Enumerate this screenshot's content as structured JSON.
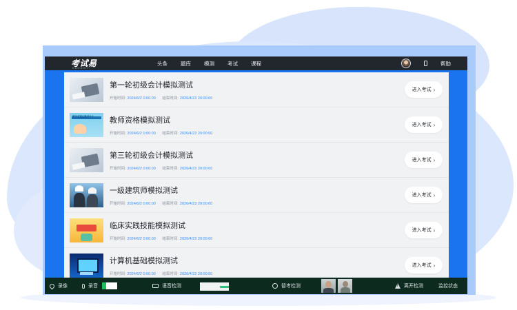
{
  "header": {
    "logo": "考试易",
    "logo_sub": "KAOSHIYI",
    "nav": [
      "头条",
      "题库",
      "模测",
      "考试",
      "课程"
    ],
    "help": "帮助"
  },
  "exams": [
    {
      "title": "第一轮初级会计模拟测试",
      "thumb": "calculator-thumbnail",
      "start_label": "开始时间:",
      "start": "2024/6/2 0:00:00",
      "end_label": "结束时间:",
      "end": "2026/4/23 20:00:00",
      "button": "进入考试"
    },
    {
      "title": "教师资格模拟测试",
      "thumb": "teacher-thumbnail",
      "thumb_text": "教师资格证备考什么",
      "start_label": "开始时间:",
      "start": "2024/6/2 0:00:00",
      "end_label": "结束时间:",
      "end": "2026/4/23 20:00:00",
      "button": "进入考试"
    },
    {
      "title": "第三轮初级会计模拟测试",
      "thumb": "calculator-thumbnail",
      "start_label": "开始时间:",
      "start": "2024/6/2 0:00:00",
      "end_label": "结束时间:",
      "end": "2026/4/23 20:00:00",
      "button": "进入考试"
    },
    {
      "title": "一级建筑师模拟测试",
      "thumb": "architects-thumbnail",
      "start_label": "开始时间:",
      "start": "2024/6/2 0:00:00",
      "end_label": "结束时间:",
      "end": "2026/4/23 20:00:00",
      "button": "进入考试"
    },
    {
      "title": "临床实践技能模拟测试",
      "thumb": "clinical-thumbnail",
      "start_label": "开始时间:",
      "start": "2024/6/2 0:00:00",
      "end_label": "结束时间:",
      "end": "2026/4/23 20:00:00",
      "button": "进入考试"
    },
    {
      "title": "计算机基础模拟测试",
      "thumb": "computer-thumbnail",
      "start_label": "开始时间:",
      "start": "2024/6/2 0:00:00",
      "end_label": "结束时间:",
      "end": "2026/4/23 20:00:00",
      "button": "进入考试"
    }
  ],
  "statusbar": {
    "record_screen": "录像",
    "record_audio": "录音",
    "audio_level": 0.25,
    "voice_detect": "语音检测",
    "voice_level": 0.3,
    "face_detect": "替考检测",
    "leave_detect": "离开检测",
    "monitor_status": "监控状态"
  },
  "colors": {
    "frame_blue": "#1a74f0",
    "nav_dark": "#22262d",
    "statusbar_green": "#0c2a1d",
    "time_value_blue": "#3d8ef0"
  }
}
